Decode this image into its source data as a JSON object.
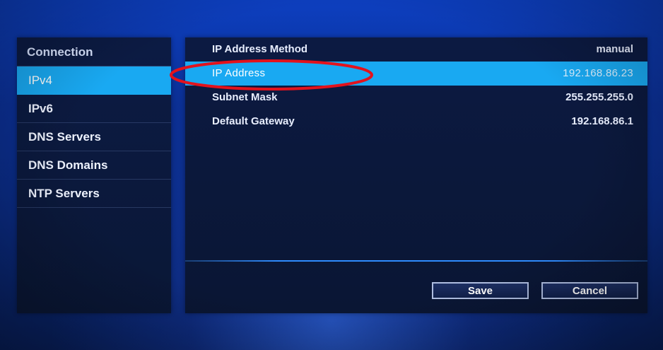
{
  "sidebar": {
    "heading": "Connection",
    "items": [
      {
        "label": "IPv4"
      },
      {
        "label": "IPv6"
      },
      {
        "label": "DNS Servers"
      },
      {
        "label": "DNS Domains"
      },
      {
        "label": "NTP Servers"
      }
    ],
    "selected_index": 0
  },
  "main": {
    "rows": [
      {
        "label": "IP Address Method",
        "value": "manual"
      },
      {
        "label": "IP Address",
        "value": "192.168.86.23"
      },
      {
        "label": "Subnet Mask",
        "value": "255.255.255.0"
      },
      {
        "label": "Default Gateway",
        "value": "192.168.86.1"
      }
    ],
    "selected_index": 1
  },
  "buttons": {
    "save_label": "Save",
    "cancel_label": "Cancel"
  },
  "colors": {
    "selection": "#19a9f2",
    "panel": "#0b183b",
    "background": "#0b2f93",
    "annotation": "#e3121c"
  }
}
